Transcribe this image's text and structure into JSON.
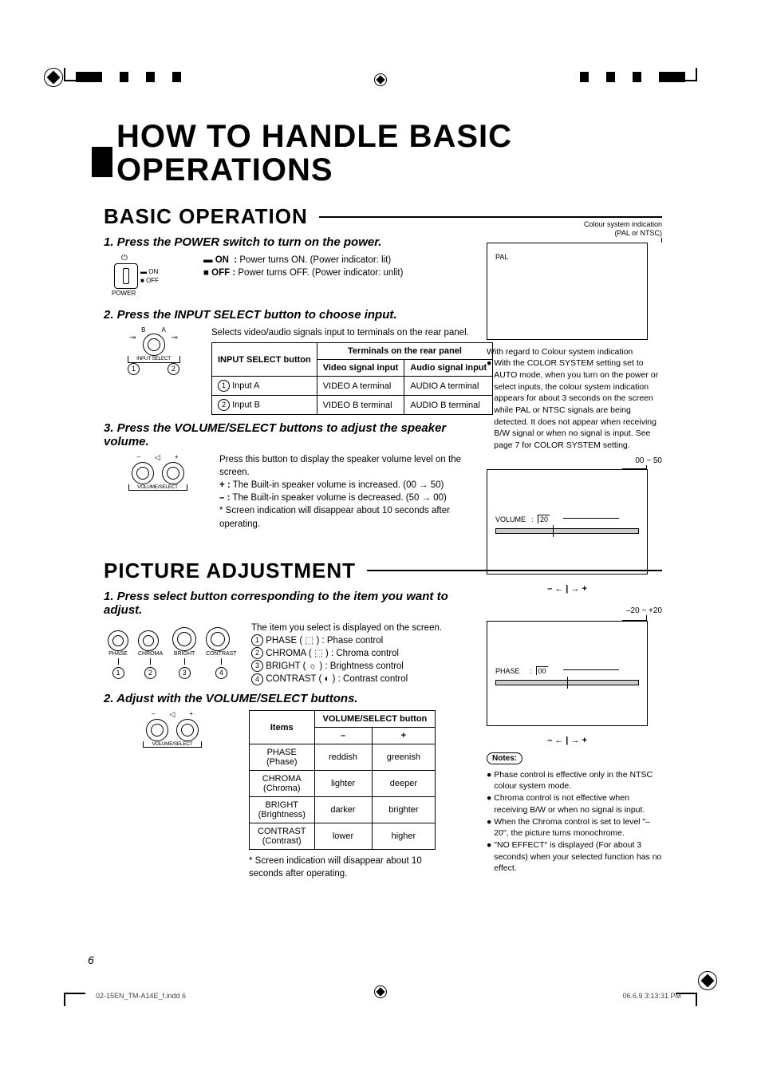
{
  "title": {
    "line1": "HOW TO HANDLE BASIC",
    "line2": "OPERATIONS"
  },
  "section1": {
    "heading": "BASIC OPERATION",
    "step1": {
      "title": "1. Press the POWER switch to turn on the power.",
      "on_label": "ON",
      "off_label": "OFF",
      "power_label": "POWER",
      "on_desc": "Power turns ON. (Power indicator: lit)",
      "off_desc": "Power turns OFF. (Power indicator: unlit)"
    },
    "step2": {
      "title": "2. Press the INPUT SELECT button to choose input.",
      "desc": "Selects video/audio signals input to terminals on the rear panel.",
      "table": {
        "head_input": "INPUT SELECT button",
        "head_terminals": "Terminals on the rear panel",
        "head_video": "Video signal input",
        "head_audio": "Audio signal input",
        "rows": [
          {
            "name": "Input A",
            "video": "VIDEO A terminal",
            "audio": "AUDIO A terminal"
          },
          {
            "name": "Input B",
            "video": "VIDEO B terminal",
            "audio": "AUDIO B terminal"
          }
        ]
      }
    },
    "step3": {
      "title": "3. Press the VOLUME/SELECT buttons to adjust the speaker volume.",
      "desc": "Press this button to display the speaker volume level on the screen.",
      "plus": "The Built-in speaker volume is increased. (00 → 50)",
      "minus": "The Built-in speaker volume is decreased. (50 → 00)",
      "note": "* Screen indication will disappear about 10 seconds after operating."
    }
  },
  "section2": {
    "heading": "PICTURE ADJUSTMENT",
    "step1": {
      "title": "1. Press select button corresponding to the item you want to adjust.",
      "desc": "The item you select is displayed on the screen.",
      "knobs": [
        "PHASE",
        "CHROMA",
        "BRIGHT",
        "CONTRAST"
      ],
      "items": [
        "PHASE ( ⬚ ) : Phase control",
        "CHROMA ( ⬚ ) : Chroma control",
        "BRIGHT ( ☼ ) : Brightness control",
        "CONTRAST ( ◐ ) : Contrast control"
      ]
    },
    "step2": {
      "title": "2. Adjust with the VOLUME/SELECT buttons.",
      "table": {
        "head_items": "Items",
        "head_vol": "VOLUME/SELECT button",
        "rows": [
          {
            "name": "PHASE",
            "sub": "Phase",
            "minus": "reddish",
            "plus": "greenish"
          },
          {
            "name": "CHROMA",
            "sub": "Chroma",
            "minus": "lighter",
            "plus": "deeper"
          },
          {
            "name": "BRIGHT",
            "sub": "Brightness",
            "minus": "darker",
            "plus": "brighter"
          },
          {
            "name": "CONTRAST",
            "sub": "Contrast",
            "minus": "lower",
            "plus": "higher"
          }
        ]
      },
      "footnote": "* Screen indication will disappear about 10 seconds after operating."
    }
  },
  "sidebar": {
    "osd1": {
      "caption1": "Colour system indication",
      "caption2": "PAL or NTSC",
      "value": "PAL",
      "note_heading": "With regard to Colour system indication",
      "note_body": "With the COLOR SYSTEM setting set to AUTO mode, when you turn on the power or select inputs, the colour system indication appears for about 3 seconds on the screen while PAL or NTSC signals are being detected. It does not appear when receiving B/W signal or when no signal is input. See page 7 for COLOR SYSTEM setting."
    },
    "osd2": {
      "range": "00 ~ 50",
      "label": "VOLUME",
      "value": "20"
    },
    "osd3": {
      "range": "–20 ~ +20",
      "label": "PHASE",
      "value": "00"
    },
    "notes": {
      "heading": "Notes:",
      "items": [
        "Phase control is effective only in the NTSC colour system mode.",
        "Chroma control is not effective when receiving B/W or when no signal is input.",
        "When the Chroma control is set to level \"–20\", the picture turns monochrome.",
        "\"NO EFFECT\" is displayed (For about 3 seconds) when your selected function has no effect."
      ]
    }
  },
  "footer": {
    "page": "6",
    "left": "02-15EN_TM-A14E_f.indd   6",
    "right": "06.6.9   3:13:31 PM"
  }
}
